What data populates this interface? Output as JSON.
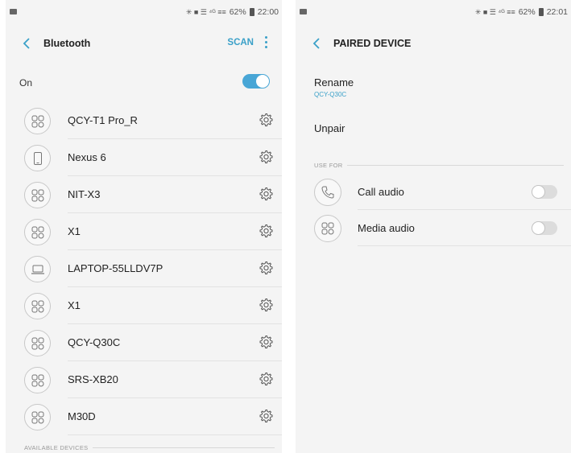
{
  "left": {
    "status": {
      "time": "22:00",
      "battery": "62%",
      "signal": "✳ ■ ☰ ⁴ᴳ ≡≡"
    },
    "title": "Bluetooth",
    "scan_label": "SCAN",
    "on_label": "On",
    "bluetooth_on": true,
    "devices": [
      {
        "name": "QCY-T1 Pro_R",
        "icon": "headset-icon"
      },
      {
        "name": "Nexus 6",
        "icon": "phone-icon"
      },
      {
        "name": "NIT-X3",
        "icon": "headset-icon"
      },
      {
        "name": "X1",
        "icon": "headset-icon"
      },
      {
        "name": "LAPTOP-55LLDV7P",
        "icon": "laptop-icon"
      },
      {
        "name": "X1",
        "icon": "headset-icon"
      },
      {
        "name": "QCY-Q30C",
        "icon": "headset-icon"
      },
      {
        "name": "SRS-XB20",
        "icon": "headset-icon"
      },
      {
        "name": "M30D",
        "icon": "headset-icon"
      }
    ],
    "available_label": "AVAILABLE DEVICES"
  },
  "right": {
    "status": {
      "time": "22:01",
      "battery": "62%",
      "signal": "✳ ■ ☰ ⁴ᴳ ≡≡"
    },
    "title": "PAIRED DEVICE",
    "rename_label": "Rename",
    "rename_value": "QCY-Q30C",
    "unpair_label": "Unpair",
    "use_for_label": "USE FOR",
    "options": [
      {
        "label": "Call audio",
        "icon": "phone-handset-icon",
        "enabled": false
      },
      {
        "label": "Media audio",
        "icon": "headset-icon",
        "enabled": false
      }
    ]
  },
  "colors": {
    "accent": "#3aa0c8",
    "switch_on": "#48a6d6",
    "background": "#f4f4f4"
  }
}
